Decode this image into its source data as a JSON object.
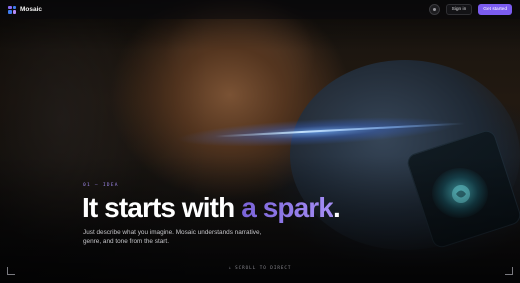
{
  "brand": {
    "name": "Mosaic",
    "logo_colors": [
      "#8b6cf7",
      "#3f7df0",
      "#3f7df0",
      "#b58cf9"
    ]
  },
  "nav": {
    "theme_icon": "circle-dot-icon",
    "signin_label": "Sign in",
    "cta_label": "Get started",
    "cta_color": "#7b5cf0"
  },
  "hero": {
    "eyebrow": "01 — IDEA",
    "headline_lead": "It starts with ",
    "headline_accent": "a spark",
    "headline_tail": ".",
    "subtitle": "Just describe what you imagine. Mosaic understands narrative, genre, and tone from the start.",
    "accent_color": "#9e86e8"
  },
  "footer": {
    "scroll_icon": "arrow-down-icon",
    "scroll_hint": "SCROLL TO DIRECT"
  }
}
